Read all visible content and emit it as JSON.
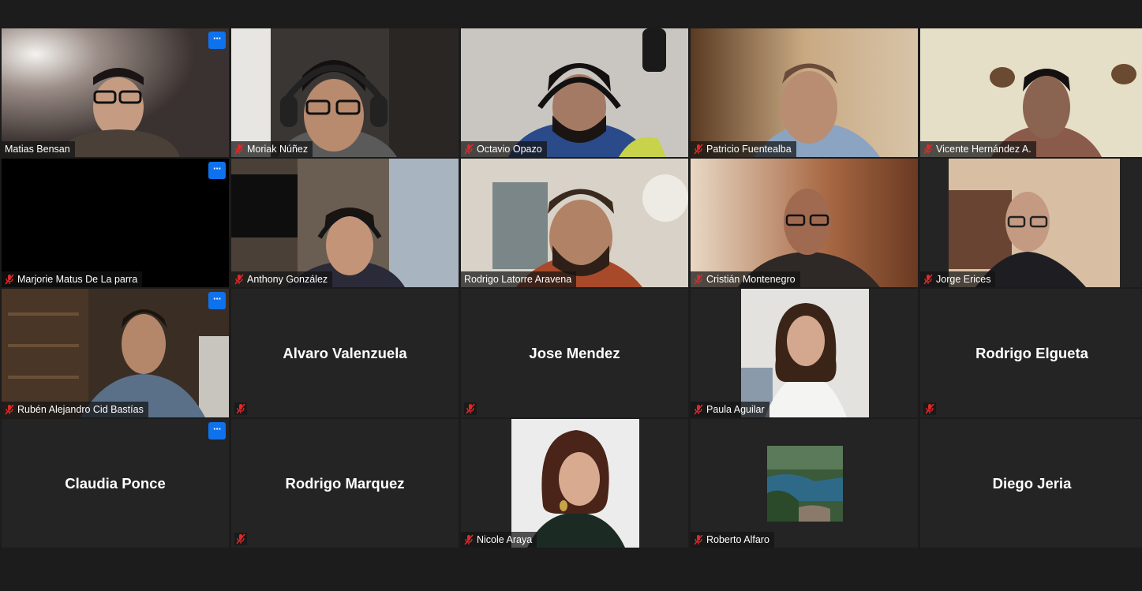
{
  "participants": [
    {
      "name": "Matias Bensan",
      "muted": false,
      "active_speaker": true,
      "video": true
    },
    {
      "name": "Moriak Núñez",
      "muted": true,
      "video": true
    },
    {
      "name": "Octavio Opazo",
      "muted": true,
      "video": true
    },
    {
      "name": "Patricio Fuentealba",
      "muted": true,
      "video": true
    },
    {
      "name": "Vicente Hernández A.",
      "muted": true,
      "video": true
    },
    {
      "name": "Marjorie Matus De La parra",
      "muted": true,
      "video": true
    },
    {
      "name": "Anthony González",
      "muted": true,
      "video": true
    },
    {
      "name": "Rodrigo Latorre Aravena",
      "muted": false,
      "video": true
    },
    {
      "name": "Cristián Montenegro",
      "muted": true,
      "video": true
    },
    {
      "name": "Jorge Erices",
      "muted": true,
      "video": true
    },
    {
      "name": "Rubén Alejandro Cid Bastías",
      "muted": true,
      "video": true
    },
    {
      "name": "Alvaro Valenzuela",
      "muted": true,
      "video": false
    },
    {
      "name": "Jose Mendez",
      "muted": true,
      "video": false
    },
    {
      "name": "Paula Aguilar",
      "muted": true,
      "video": true
    },
    {
      "name": "Rodrigo Elgueta",
      "muted": true,
      "video": false
    },
    {
      "name": "Claudia Ponce",
      "muted": false,
      "video": false
    },
    {
      "name": "Rodrigo Marquez",
      "muted": true,
      "video": false
    },
    {
      "name": "Nicole Araya",
      "muted": true,
      "video": true
    },
    {
      "name": "Roberto Alfaro",
      "muted": true,
      "video": true
    },
    {
      "name": "Diego Jeria",
      "muted": false,
      "video": false
    }
  ],
  "more_button_label": "···",
  "colors": {
    "background": "#1c1c1c",
    "tile": "#242424",
    "active_speaker_border": "#d9d62a",
    "more_button": "#0e72ed",
    "muted_icon": "#e02828"
  },
  "icons": {
    "muted": "microphone-muted-icon",
    "more": "more-options-icon"
  }
}
